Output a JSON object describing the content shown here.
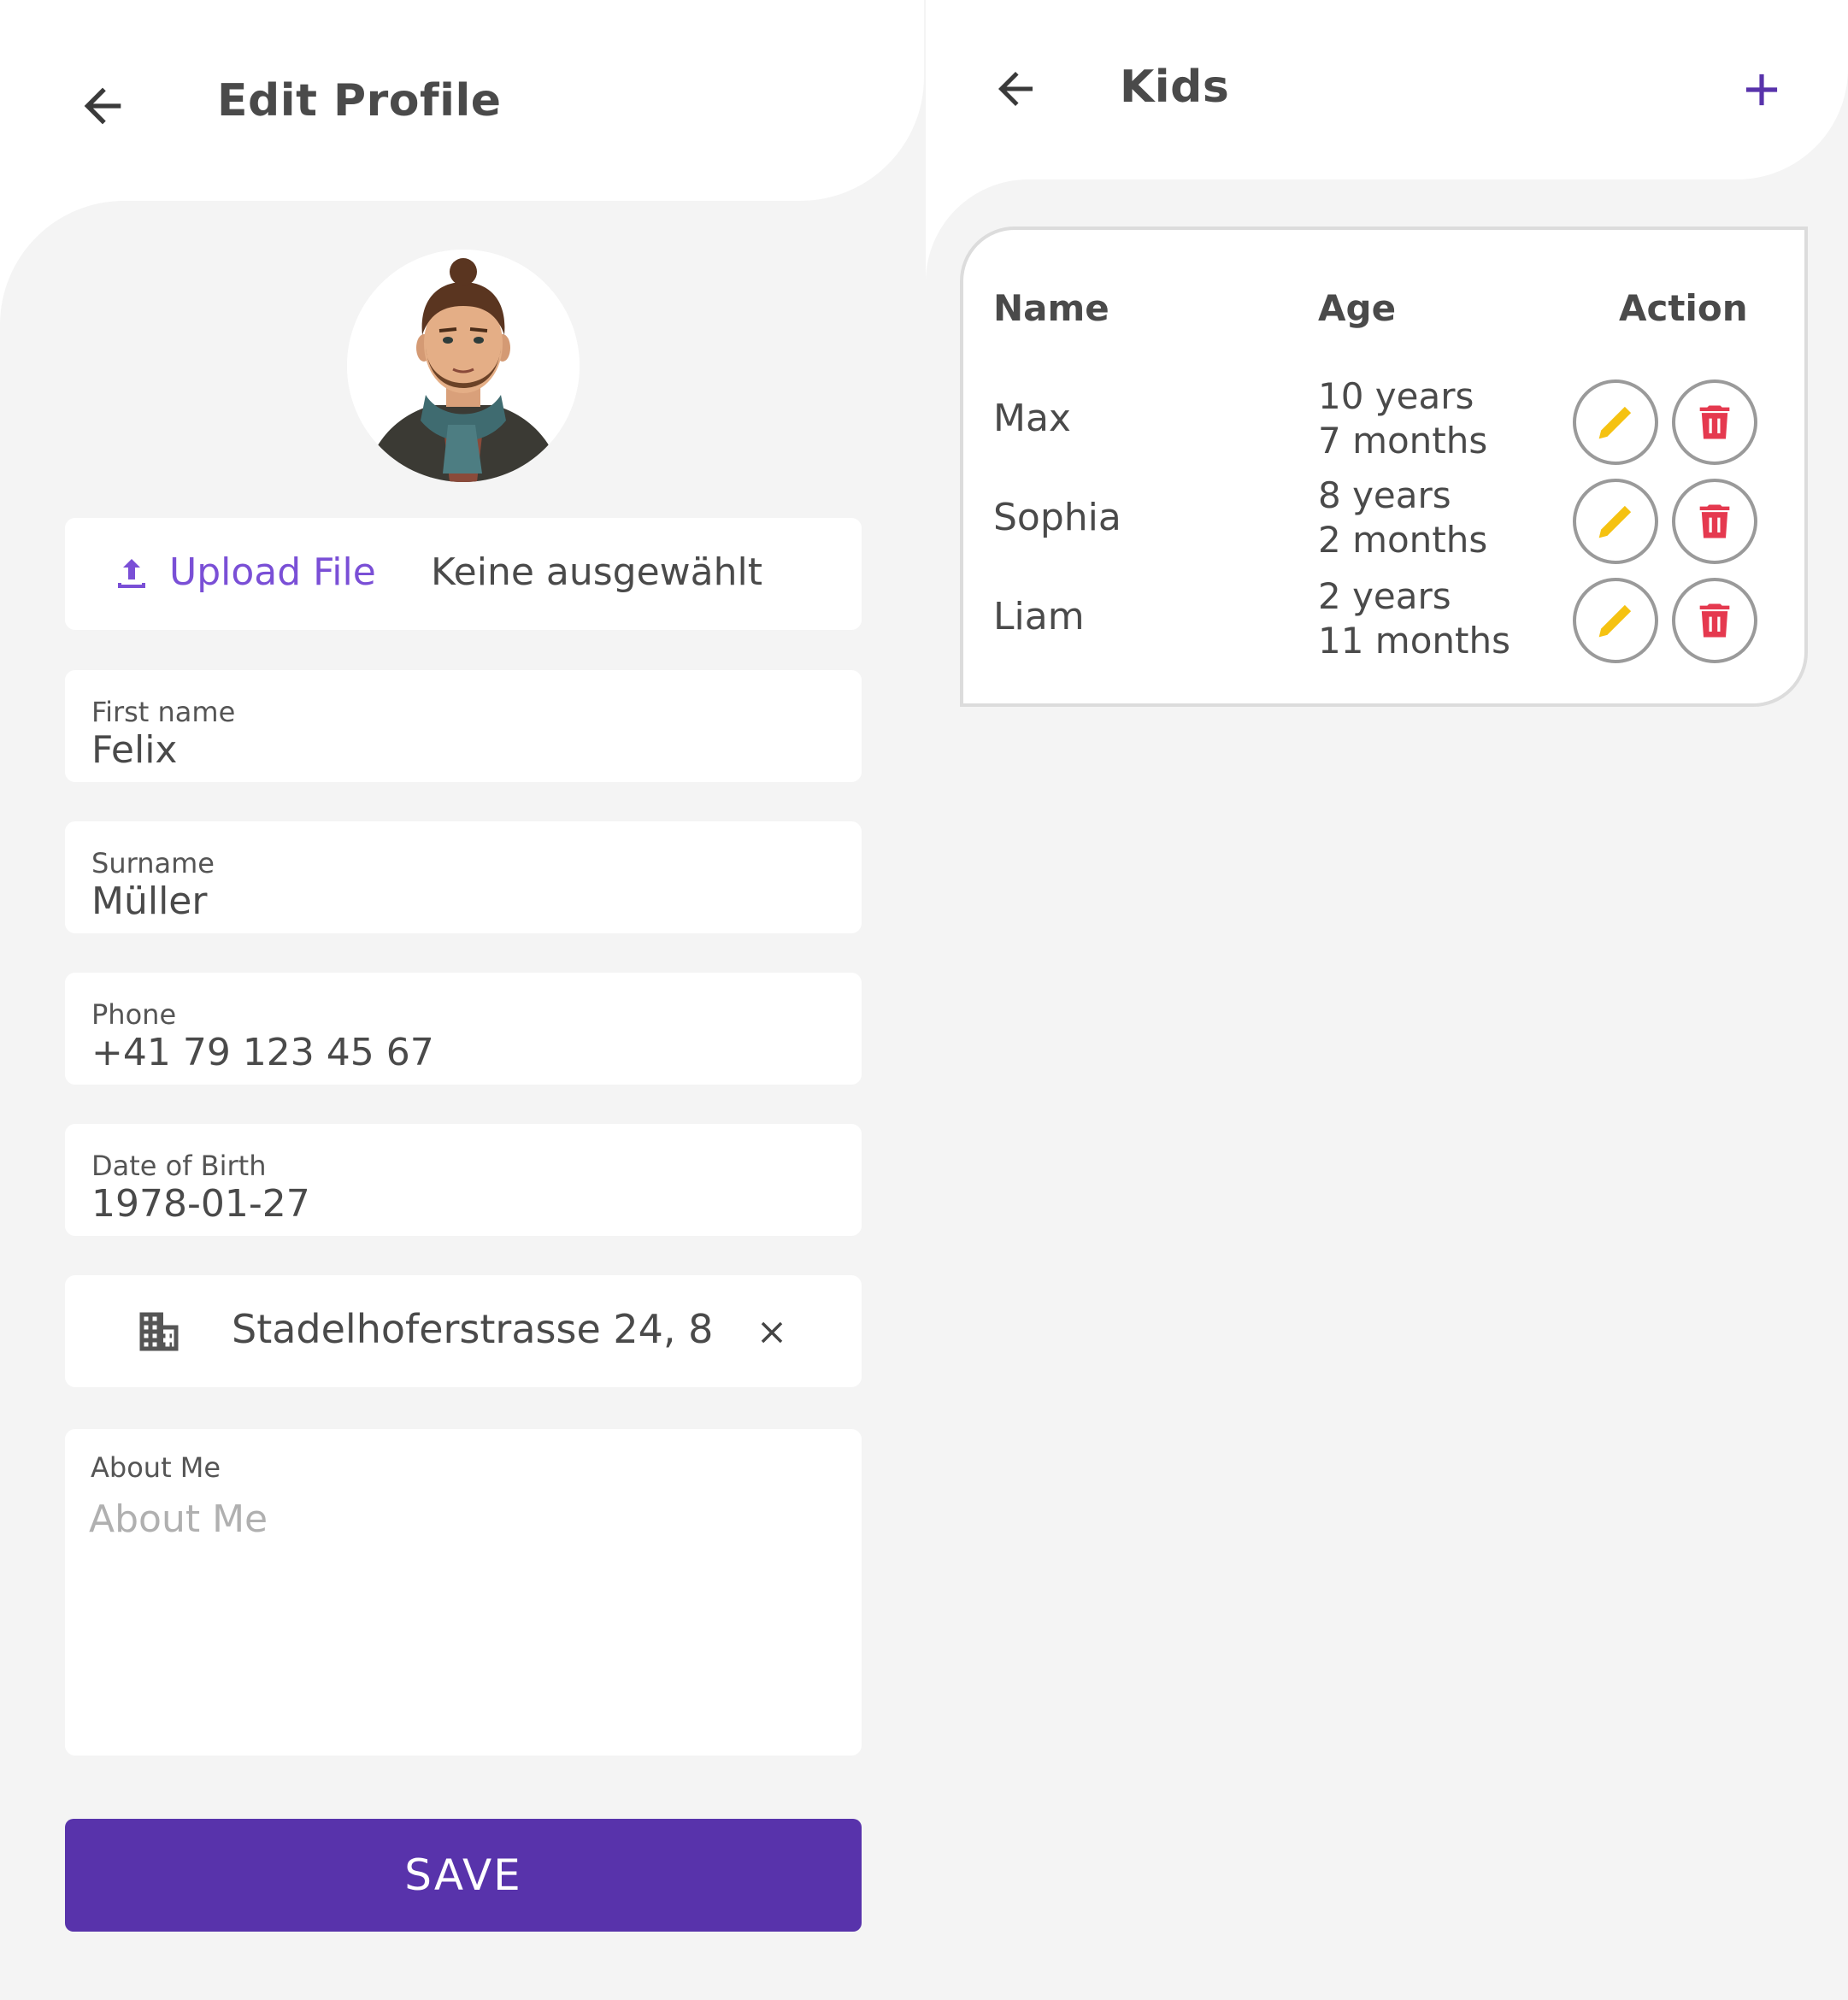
{
  "edit_profile": {
    "title": "Edit Profile",
    "upload": {
      "button_label": "Upload File",
      "file_status": "Keine ausgewählt"
    },
    "fields": {
      "first_name": {
        "label": "First name",
        "value": "Felix"
      },
      "surname": {
        "label": "Surname",
        "value": "Müller"
      },
      "phone": {
        "label": "Phone",
        "value": "+41 79 123 45 67"
      },
      "dob": {
        "label": "Date of Birth",
        "value": "1978-01-27"
      }
    },
    "address": {
      "value": "Stadelhoferstrasse 24, 8"
    },
    "about": {
      "label": "About Me",
      "placeholder": "About Me",
      "value": ""
    },
    "save_label": "SAVE"
  },
  "kids": {
    "title": "Kids",
    "columns": {
      "name": "Name",
      "age": "Age",
      "action": "Action"
    },
    "rows": [
      {
        "name": "Max",
        "age_years": "10 years",
        "age_months": "7 months"
      },
      {
        "name": "Sophia",
        "age_years": "8 years",
        "age_months": "2 months"
      },
      {
        "name": "Liam",
        "age_years": "2 years",
        "age_months": "11 months"
      }
    ]
  },
  "colors": {
    "accent": "#5833ab",
    "upload_text": "#7a4fd6",
    "edit_icon": "#f5c211",
    "delete_icon": "#e5394f",
    "background": "#f4f4f4"
  },
  "icons": [
    "back-arrow-icon",
    "upload-icon",
    "building-icon",
    "close-icon",
    "plus-icon",
    "pencil-icon",
    "trash-icon"
  ]
}
